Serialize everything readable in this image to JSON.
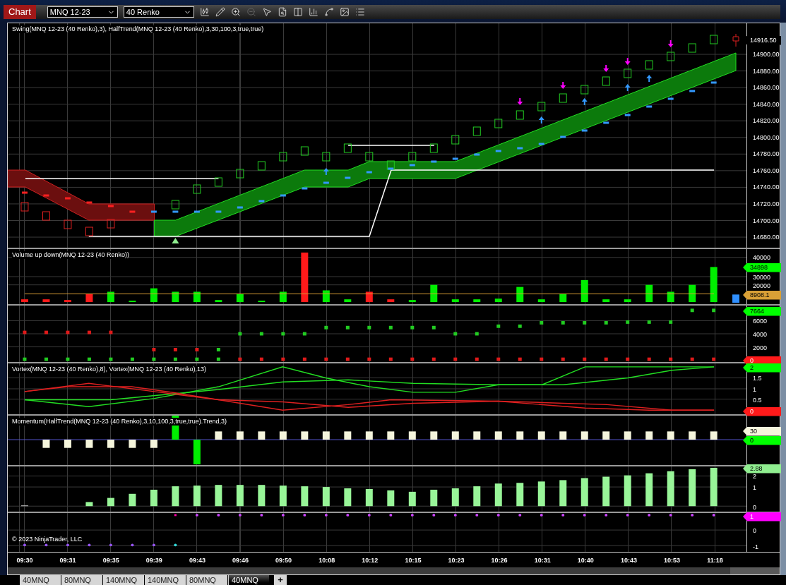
{
  "toolbar": {
    "title": "Chart",
    "instrument": "MNQ 12-23",
    "bar_type": "40 Renko"
  },
  "panels": [
    {
      "kind": "price",
      "title": "Swing(MNQ 12-23 (40 Renko),3), HalfTrend(MNQ 12-23 (40 Renko),3,30,100,3,true,true)",
      "ticks": [
        "14900.00",
        "14880.00",
        "14860.00",
        "14840.00",
        "14820.00",
        "14800.00",
        "14780.00",
        "14760.00",
        "14740.00",
        "14720.00",
        "14700.00",
        "14680.00"
      ],
      "badges": [
        {
          "text": "14916.50",
          "color": "#000000"
        }
      ]
    },
    {
      "kind": "volume",
      "title": "Volume up down(MNQ 12-23 (40 Renko))",
      "ticks": [
        "40000",
        "30000",
        "20000"
      ],
      "badges": [
        {
          "text": "34898",
          "color": "#00ff00"
        },
        {
          "text": "8908.1",
          "color": "#d9a036"
        }
      ]
    },
    {
      "kind": "count",
      "ticks": [
        "6000",
        "4000",
        "2000"
      ],
      "badges": [
        {
          "text": "7664",
          "color": "#00ff00"
        },
        {
          "text": "0",
          "color": "#ff1a1a"
        }
      ]
    },
    {
      "kind": "vortex",
      "title": "Vortex(MNQ 12-23 (40 Renko),8), Vortex(MNQ 12-23 (40 Renko),13)",
      "ticks": [
        "1.5",
        "1",
        "0.5"
      ],
      "badges": [
        {
          "text": "2",
          "color": "#00ff00"
        },
        {
          "text": "0",
          "color": "#ff1a1a"
        }
      ]
    },
    {
      "kind": "momentum",
      "title": "Momentum(HalfTrend(MNQ 12-23 (40 Renko),3,10,100,3,true,true).Trend,3)",
      "badges": [
        {
          "text": "30",
          "color": "#f5f5dc"
        },
        {
          "text": "0",
          "color": "#00ff00"
        }
      ]
    },
    {
      "kind": "trend",
      "ticks": [
        "2",
        "1",
        "0"
      ],
      "badges": [
        {
          "text": "2.88",
          "color": "#90ee90"
        }
      ]
    },
    {
      "kind": "signal",
      "note": "© 2023 NinjaTrader, LLC",
      "ticks": [
        "0",
        "-1"
      ],
      "badges": [
        {
          "text": "1",
          "color": "#ff00ff"
        }
      ]
    }
  ],
  "time_axis": [
    "09:30",
    "09:31",
    "09:35",
    "09:39",
    "09:43",
    "09:46",
    "09:50",
    "10:08",
    "10:12",
    "10:15",
    "10:23",
    "10:26",
    "10:31",
    "10:40",
    "10:43",
    "10:53",
    "11:18"
  ],
  "tabs": [
    {
      "label": "40MNQ",
      "selected": false
    },
    {
      "label": "80MNQ",
      "selected": false
    },
    {
      "label": "140MNQ",
      "selected": false
    },
    {
      "label": "140MNQ",
      "selected": false
    },
    {
      "label": "80MNQ",
      "selected": false
    },
    {
      "label": "40MNQ",
      "selected": true
    }
  ],
  "add_tab": "+"
}
